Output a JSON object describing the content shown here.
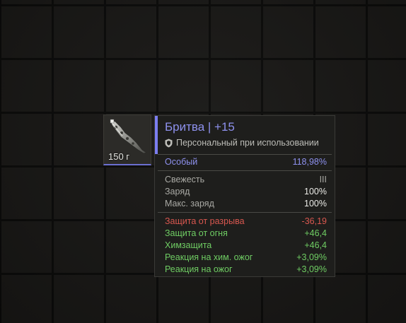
{
  "item": {
    "weight": "150 г",
    "icon": "razor-blade-icon"
  },
  "tooltip": {
    "title": "Бритва | +15",
    "subtitle": "Персональный при использовании",
    "rarity": {
      "label": "Особый",
      "value": "118,98%"
    },
    "stats": [
      {
        "label": "Свежесть",
        "value": "III"
      },
      {
        "label": "Заряд",
        "value": "100%"
      },
      {
        "label": "Макс. заряд",
        "value": "100%"
      }
    ],
    "protections": [
      {
        "label": "Защита от разрыва",
        "value": "-36,19"
      },
      {
        "label": "Защита от огня",
        "value": "+46,4"
      },
      {
        "label": "Химзащита",
        "value": "+46,4"
      },
      {
        "label": "Реакция на хим. ожог",
        "value": "+3,09%"
      },
      {
        "label": "Реакция на ожог",
        "value": "+3,09%"
      }
    ]
  },
  "colors": {
    "accent": "#7c7ef0",
    "negative": "#d8574f",
    "positive": "#6fcd63"
  }
}
